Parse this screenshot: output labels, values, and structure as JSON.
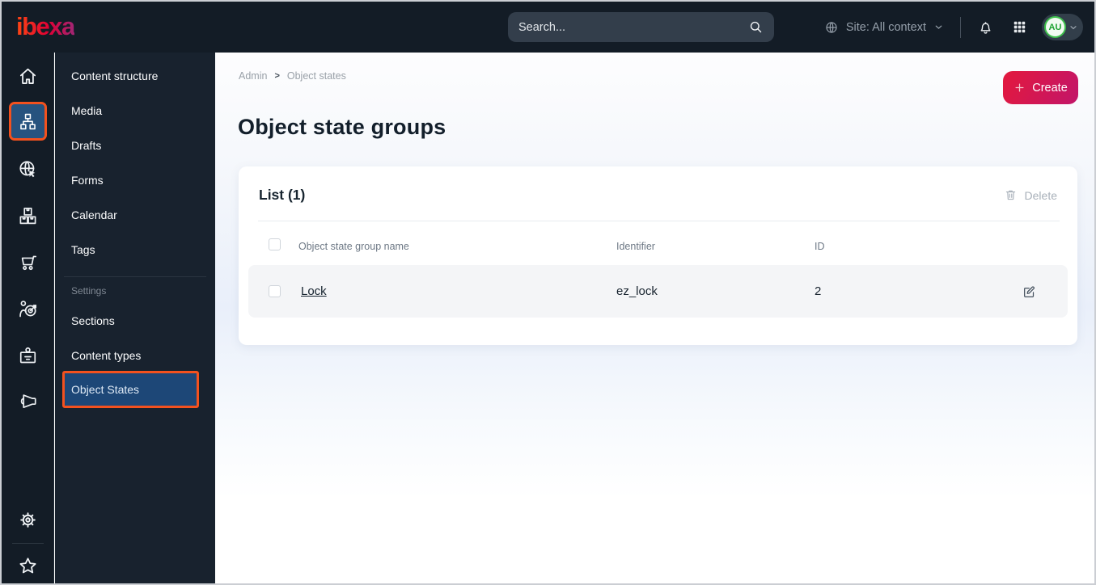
{
  "topbar": {
    "logo": "ibexa",
    "search_placeholder": "Search...",
    "site_context_label": "Site: All context",
    "avatar_initials": "AU"
  },
  "sidebar": {
    "rail_icons": [
      "home-icon",
      "content-structure-icon",
      "site-globe-icon",
      "products-boxes-icon",
      "commerce-cart-icon",
      "personalization-target-icon",
      "admin-badge-icon",
      "marketing-megaphone-icon",
      "settings-gear-icon",
      "bookmarks-star-icon"
    ],
    "active_rail_icon": "content-structure-icon",
    "menu": [
      {
        "label": "Content structure"
      },
      {
        "label": "Media"
      },
      {
        "label": "Drafts"
      },
      {
        "label": "Forms"
      },
      {
        "label": "Calendar"
      },
      {
        "label": "Tags"
      }
    ],
    "settings_heading": "Settings",
    "settings_menu": [
      {
        "label": "Sections"
      },
      {
        "label": "Content types"
      },
      {
        "label": "Object States",
        "active": true
      }
    ]
  },
  "main": {
    "breadcrumb": [
      "Admin",
      "Object states"
    ],
    "create_button": "Create",
    "page_title": "Object state groups",
    "list_card": {
      "title": "List (1)",
      "delete_button": "Delete",
      "columns": [
        "Object state group name",
        "Identifier",
        "ID"
      ],
      "rows": [
        {
          "name": "Lock",
          "identifier": "ez_lock",
          "id": "2"
        }
      ]
    }
  },
  "colors": {
    "topbar_bg": "#131c26",
    "panel_bg": "#18222e",
    "annotation_orange": "#f3511e",
    "active_blue": "#1d4777",
    "button_gradient_start": "#e3193d",
    "button_gradient_end": "#c21569",
    "avatar_green": "#3ec04c",
    "row_bg": "#f4f5f7"
  }
}
